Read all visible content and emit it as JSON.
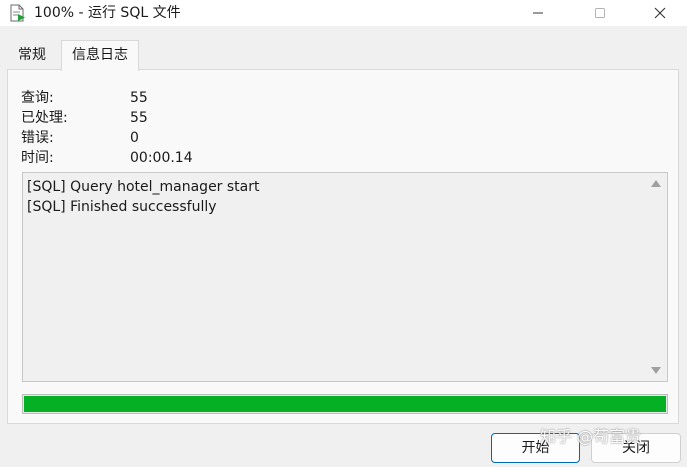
{
  "window": {
    "title": "100% - 运行 SQL 文件",
    "icon": "run-sql-file-icon"
  },
  "tabs": [
    {
      "label": "常规",
      "active": false
    },
    {
      "label": "信息日志",
      "active": true
    }
  ],
  "stats": [
    {
      "label": "查询:",
      "value": "55"
    },
    {
      "label": "已处理:",
      "value": "55"
    },
    {
      "label": "错误:",
      "value": "0"
    },
    {
      "label": "时间:",
      "value": "00:00.14"
    }
  ],
  "log": [
    "[SQL] Query hotel_manager start",
    "[SQL] Finished successfully"
  ],
  "progress": {
    "fraction": 1.0,
    "color": "#06b025"
  },
  "buttons": {
    "start": "开始",
    "close": "关闭"
  },
  "watermark": "知乎 @苟富贵"
}
